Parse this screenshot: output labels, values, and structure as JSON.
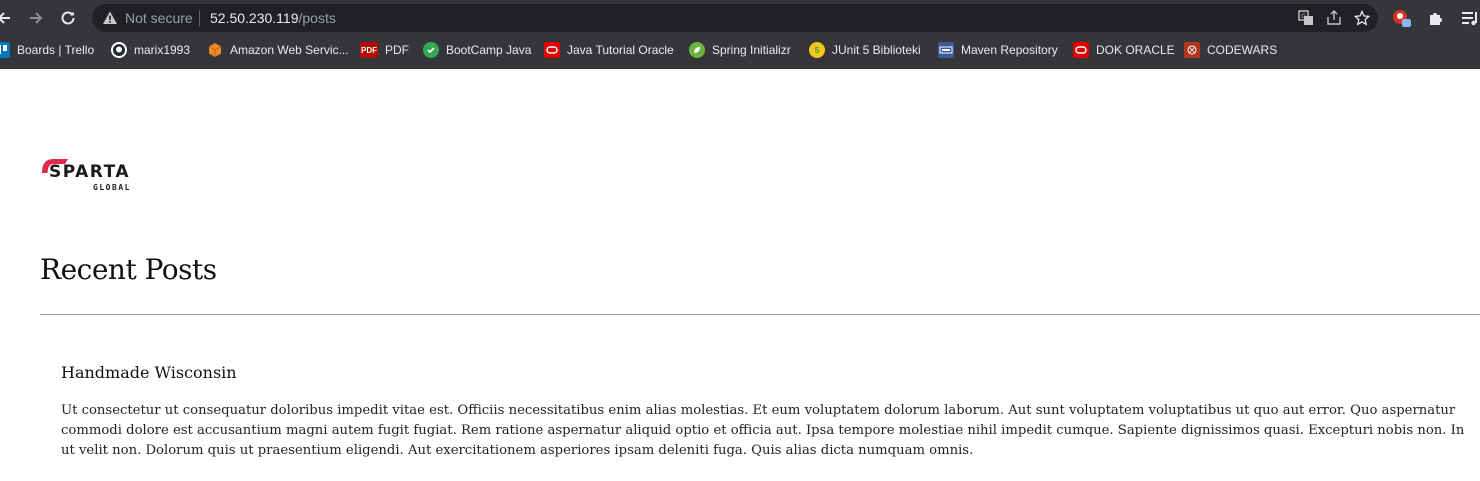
{
  "browser": {
    "security_label": "Not secure",
    "url_host": "52.50.230.119",
    "url_path": "/posts",
    "nav": {
      "back_icon": "arrow-left-icon",
      "forward_icon": "arrow-right-icon",
      "reload_icon": "reload-icon"
    },
    "omnibox_icons": [
      "translate-icon",
      "share-icon",
      "star-icon"
    ],
    "extension_icons": [
      "profile-extension-icon",
      "puzzle-icon",
      "reading-list-icon"
    ]
  },
  "bookmarks": [
    {
      "label": "Boards | Trello",
      "icon": "trello-icon",
      "color": "#0079bf"
    },
    {
      "label": "marix1993",
      "icon": "github-icon",
      "color": "#ffffff"
    },
    {
      "label": "Amazon Web Servic...",
      "icon": "aws-icon",
      "color": "#f08a24"
    },
    {
      "label": "PDF",
      "icon": "pdf-icon",
      "color": "#b30b00"
    },
    {
      "label": "BootCamp Java",
      "icon": "bootcamp-icon",
      "color": "#34a853"
    },
    {
      "label": "Java Tutorial Oracle",
      "icon": "oracle-icon",
      "color": "#e00000"
    },
    {
      "label": "Spring Initializr",
      "icon": "spring-icon",
      "color": "#6db33f"
    },
    {
      "label": "JUnit 5 Biblioteki",
      "icon": "junit-icon",
      "color": "#25a162"
    },
    {
      "label": "Maven Repository",
      "icon": "maven-icon",
      "color": "#3a5a9a"
    },
    {
      "label": "DOK ORACLE",
      "icon": "oracle-icon",
      "color": "#e00000"
    },
    {
      "label": "CODEWARS",
      "icon": "codewars-icon",
      "color": "#b1361e"
    }
  ],
  "page": {
    "logo_text": "SPARTA",
    "logo_subtext": "GLOBAL",
    "heading": "Recent Posts",
    "posts": [
      {
        "title": "Handmade Wisconsin",
        "body": "Ut consectetur ut consequatur doloribus impedit vitae est. Officiis necessitatibus enim alias molestias. Et eum voluptatem dolorum laborum. Aut sunt voluptatem voluptatibus ut quo aut error. Quo aspernatur commodi dolore est accusantium magni autem fugit fugiat. Rem ratione aspernatur aliquid optio et officia aut. Ipsa tempore molestiae nihil impedit cumque. Sapiente dignissimos quasi. Excepturi nobis non. In ut velit non. Dolorum quis ut praesentium eligendi. Aut exercitationem asperiores ipsam deleniti fuga. Quis alias dicta numquam omnis."
      }
    ]
  },
  "colors": {
    "brand_accent": "#e0294b",
    "chrome_bg": "#35363a",
    "omnibox_bg": "#202124"
  }
}
